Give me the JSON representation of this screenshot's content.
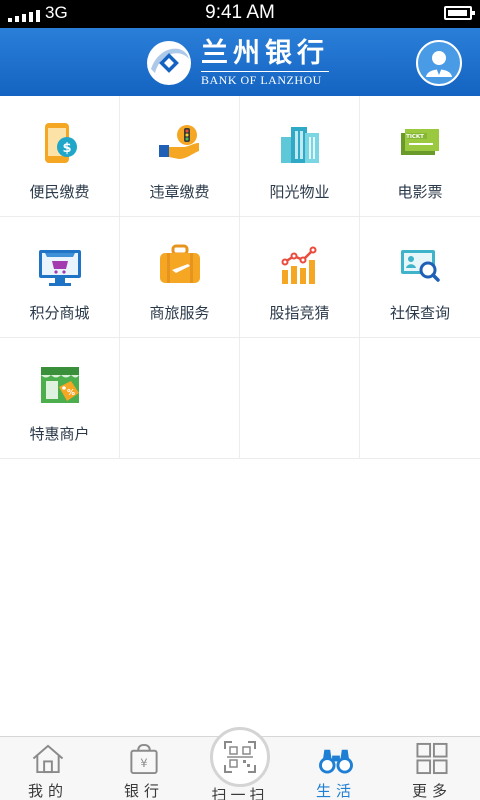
{
  "status_bar": {
    "carrier": "3G",
    "time": "9:41 AM"
  },
  "header": {
    "logo_cn": "兰州银行",
    "logo_en": "BANK OF LANZHOU",
    "profile_icon": "user-profile-icon"
  },
  "services": [
    {
      "label": "便民缴费",
      "icon": "phone-payment-icon"
    },
    {
      "label": "违章缴费",
      "icon": "traffic-fine-icon"
    },
    {
      "label": "阳光物业",
      "icon": "building-icon"
    },
    {
      "label": "电影票",
      "icon": "movie-ticket-icon"
    },
    {
      "label": "积分商城",
      "icon": "points-mall-icon"
    },
    {
      "label": "商旅服务",
      "icon": "travel-suitcase-icon"
    },
    {
      "label": "股指竞猜",
      "icon": "stock-chart-icon"
    },
    {
      "label": "社保查询",
      "icon": "social-security-search-icon"
    },
    {
      "label": "特惠商户",
      "icon": "discount-store-icon"
    }
  ],
  "ticket_text": "TICKT",
  "tabbar": {
    "tabs": [
      {
        "label": "我的",
        "icon": "home-icon"
      },
      {
        "label": "银行",
        "icon": "bank-bag-icon"
      },
      {
        "label": "扫一扫",
        "icon": "scan-qr-icon"
      },
      {
        "label": "生活",
        "icon": "binoculars-icon",
        "active": true
      },
      {
        "label": "更多",
        "icon": "grid-more-icon"
      }
    ]
  },
  "colors": {
    "brand_blue": "#1463c2",
    "active_tab": "#1e7fd4"
  }
}
